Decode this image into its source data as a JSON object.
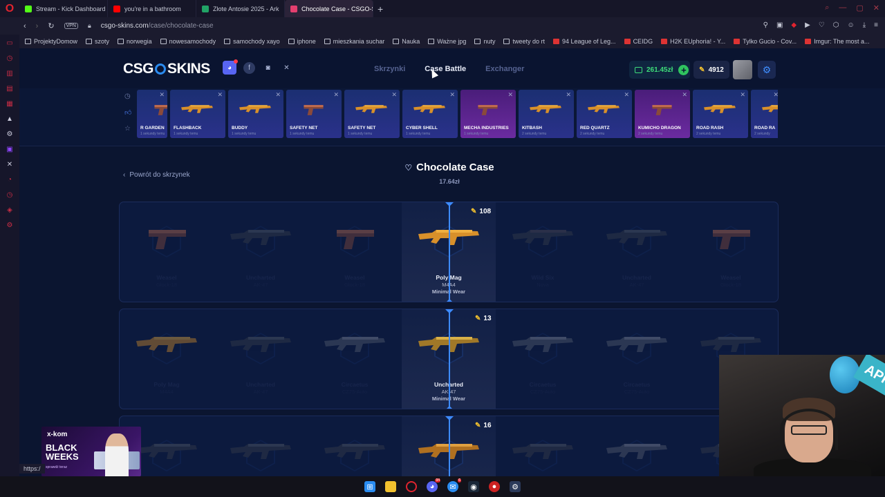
{
  "browser": {
    "tabs": [
      {
        "title": "Stream - Kick Dashboard",
        "icon": "kick-icon",
        "color": "#53fc18",
        "active": false
      },
      {
        "title": "you're in a bathroom",
        "icon": "youtube-icon",
        "color": "#ff0000",
        "active": false
      },
      {
        "title": "Złote Antosie 2025 - Ark",
        "icon": "sheets-icon",
        "color": "#21a366",
        "active": false
      },
      {
        "title": "Chocolate Case - CSGO-S",
        "icon": "site-icon",
        "color": "#e43f6f",
        "active": true
      }
    ],
    "new_tab": "+",
    "vpn": "VPN",
    "url_host": "csgo-skins.com",
    "url_path": "/case/chocolate-case",
    "bookmarks": [
      {
        "label": "ProjektyDomow",
        "icon": "folder-icon"
      },
      {
        "label": "szoty",
        "icon": "folder-icon"
      },
      {
        "label": "norwegia",
        "icon": "folder-icon"
      },
      {
        "label": "nowesamochody",
        "icon": "folder-icon"
      },
      {
        "label": "samochody xayo",
        "icon": "folder-icon"
      },
      {
        "label": "iphone",
        "icon": "folder-icon"
      },
      {
        "label": "mieszkania suchar",
        "icon": "folder-icon"
      },
      {
        "label": "Nauka",
        "icon": "folder-icon"
      },
      {
        "label": "Ważne jpg",
        "icon": "folder-icon"
      },
      {
        "label": "nuty",
        "icon": "folder-icon"
      },
      {
        "label": "tweety do rt",
        "icon": "folder-icon"
      },
      {
        "label": "94 League of Leg...",
        "icon": "site-icon"
      },
      {
        "label": "CEIDG",
        "icon": "site-icon"
      },
      {
        "label": "H2K EUphoria! - Y...",
        "icon": "youtube-icon"
      },
      {
        "label": "Tylko Gucio - Cov...",
        "icon": "youtube-icon"
      },
      {
        "label": "Imgur: The most a...",
        "icon": "site-icon"
      }
    ],
    "status_url": "https:/"
  },
  "site": {
    "logo_left": "CSG",
    "logo_right": "SKINS",
    "nav": [
      "Skrzynki",
      "Case Battle",
      "Exchanger"
    ],
    "nav_current": "Case Battle",
    "balance": "261.45zł",
    "coins": "4912",
    "accent": "#3d8bff"
  },
  "live_drops": [
    {
      "name": "R GARDEN",
      "sub": "1 sekundy temu",
      "style": "half"
    },
    {
      "name": "FLASHBACK",
      "sub": "1 sekundy temu",
      "style": "blue"
    },
    {
      "name": "BUDDY",
      "sub": "1 sekundy temu",
      "style": "blue"
    },
    {
      "name": "SAFETY NET",
      "sub": "1 sekundy temu",
      "style": "blue"
    },
    {
      "name": "SAFETY NET",
      "sub": "1 sekundy temu",
      "style": "blue"
    },
    {
      "name": "CYBER SHELL",
      "sub": "1 sekundy temu",
      "style": "blue"
    },
    {
      "name": "MECHA INDUSTRIES",
      "sub": "1 sekundy temu",
      "style": "pink"
    },
    {
      "name": "KITBASH",
      "sub": "2 sekundy temu",
      "style": "blue"
    },
    {
      "name": "RED QUARTZ",
      "sub": "2 sekundy temu",
      "style": "blue"
    },
    {
      "name": "KUMICHO DRAGON",
      "sub": "2 sekundy temu",
      "style": "pink"
    },
    {
      "name": "ROAD RASH",
      "sub": "2 sekundy temu",
      "style": "blue"
    },
    {
      "name": "ROAD RA",
      "sub": "2 sekundy",
      "style": "half"
    }
  ],
  "case": {
    "back_label": "Powrót do skrzynek",
    "title": "Chocolate Case",
    "price": "17.64zł"
  },
  "spins": [
    {
      "count": "108",
      "items": [
        {
          "name": "Weasel",
          "type": "Glock-18",
          "gun": "pistol-red"
        },
        {
          "name": "Uncharted",
          "type": "AK-47",
          "gun": "rifle-dark"
        },
        {
          "name": "Weasel",
          "type": "Glock-18",
          "gun": "pistol-red"
        },
        {
          "name": "Poly Mag",
          "type": "M4A4",
          "wear": "Minimal Wear",
          "gun": "rifle-orange",
          "win": true
        },
        {
          "name": "Wild Six",
          "type": "Nova",
          "gun": "shotgun-dark"
        },
        {
          "name": "Uncharted",
          "type": "AK-47",
          "gun": "rifle-dark"
        },
        {
          "name": "Weasel",
          "type": "Glock-18",
          "gun": "pistol-red"
        }
      ]
    },
    {
      "count": "13",
      "items": [
        {
          "name": "Poly Mag",
          "type": "M4A4",
          "gun": "rifle-orange"
        },
        {
          "name": "Uncharted",
          "type": "AK-47",
          "gun": "rifle-dark"
        },
        {
          "name": "Circaetus",
          "type": "CZ75-Auto",
          "gun": "smg-gray"
        },
        {
          "name": "Uncharted",
          "type": "AK-47",
          "wear": "Minimal Wear",
          "gun": "rifle-gold",
          "win": true
        },
        {
          "name": "Circaetus",
          "type": "CZ75-Auto",
          "gun": "smg-gray"
        },
        {
          "name": "Circaetus",
          "type": "CZ75-Auto",
          "gun": "smg-gray"
        },
        {
          "name": "U",
          "type": "",
          "gun": "rifle-dark"
        }
      ]
    },
    {
      "count": "16",
      "items": [
        {
          "name": "",
          "type": "",
          "gun": "rifle-dark"
        },
        {
          "name": "",
          "type": "",
          "gun": "rifle-dark"
        },
        {
          "name": "",
          "type": "",
          "gun": "rifle-dark"
        },
        {
          "name": "",
          "type": "",
          "gun": "shotgun-gold",
          "win": true
        },
        {
          "name": "",
          "type": "",
          "gun": "rifle-dark"
        },
        {
          "name": "",
          "type": "",
          "gun": "smg-gray"
        },
        {
          "name": "",
          "type": "",
          "gun": "rifle-dark"
        }
      ]
    }
  ],
  "ad": {
    "brand": "x-kom",
    "headline_1": "BLACK",
    "headline_2": "WEEKS",
    "sub": "sprawdź teraz"
  },
  "webcam": {
    "banner": "APP"
  }
}
